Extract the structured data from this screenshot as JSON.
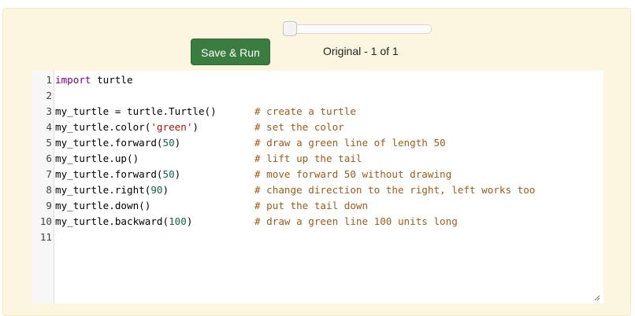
{
  "controls": {
    "run_label": "Save & Run",
    "version_label": "Original - 1 of 1",
    "slider_value": 0
  },
  "editor": {
    "lines": [
      {
        "num": "1",
        "tokens": [
          {
            "t": "import",
            "c": "kw"
          },
          {
            "t": " turtle",
            "c": ""
          }
        ],
        "comment": ""
      },
      {
        "num": "2",
        "tokens": [],
        "comment": ""
      },
      {
        "num": "3",
        "tokens": [
          {
            "t": "my_turtle = turtle.Turtle()",
            "c": ""
          }
        ],
        "comment": "# create a turtle"
      },
      {
        "num": "4",
        "tokens": [
          {
            "t": "my_turtle.color(",
            "c": ""
          },
          {
            "t": "'green'",
            "c": "str"
          },
          {
            "t": ")",
            "c": ""
          }
        ],
        "comment": "# set the color"
      },
      {
        "num": "5",
        "tokens": [
          {
            "t": "my_turtle.forward(",
            "c": ""
          },
          {
            "t": "50",
            "c": "num"
          },
          {
            "t": ")",
            "c": ""
          }
        ],
        "comment": "# draw a green line of length 50"
      },
      {
        "num": "6",
        "tokens": [
          {
            "t": "my_turtle.up()",
            "c": ""
          }
        ],
        "comment": "# lift up the tail"
      },
      {
        "num": "7",
        "tokens": [
          {
            "t": "my_turtle.forward(",
            "c": ""
          },
          {
            "t": "50",
            "c": "num"
          },
          {
            "t": ")",
            "c": ""
          }
        ],
        "comment": "# move forward 50 without drawing"
      },
      {
        "num": "8",
        "tokens": [
          {
            "t": "my_turtle.right(",
            "c": ""
          },
          {
            "t": "90",
            "c": "num"
          },
          {
            "t": ")",
            "c": ""
          }
        ],
        "comment": "# change direction to the right, left works too"
      },
      {
        "num": "9",
        "tokens": [
          {
            "t": "my_turtle.down()",
            "c": ""
          }
        ],
        "comment": "# put the tail down"
      },
      {
        "num": "10",
        "tokens": [
          {
            "t": "my_turtle.backward(",
            "c": ""
          },
          {
            "t": "100",
            "c": "num"
          },
          {
            "t": ")",
            "c": ""
          }
        ],
        "comment": "# draw a green line 100 units long"
      },
      {
        "num": "11",
        "tokens": [],
        "comment": ""
      }
    ]
  },
  "colors": {
    "panel_bg": "#fcf5e0",
    "run_button": "#3b7d41",
    "keyword": "#770088",
    "number": "#116644",
    "string": "#aa1111",
    "comment": "#a05a1a"
  }
}
